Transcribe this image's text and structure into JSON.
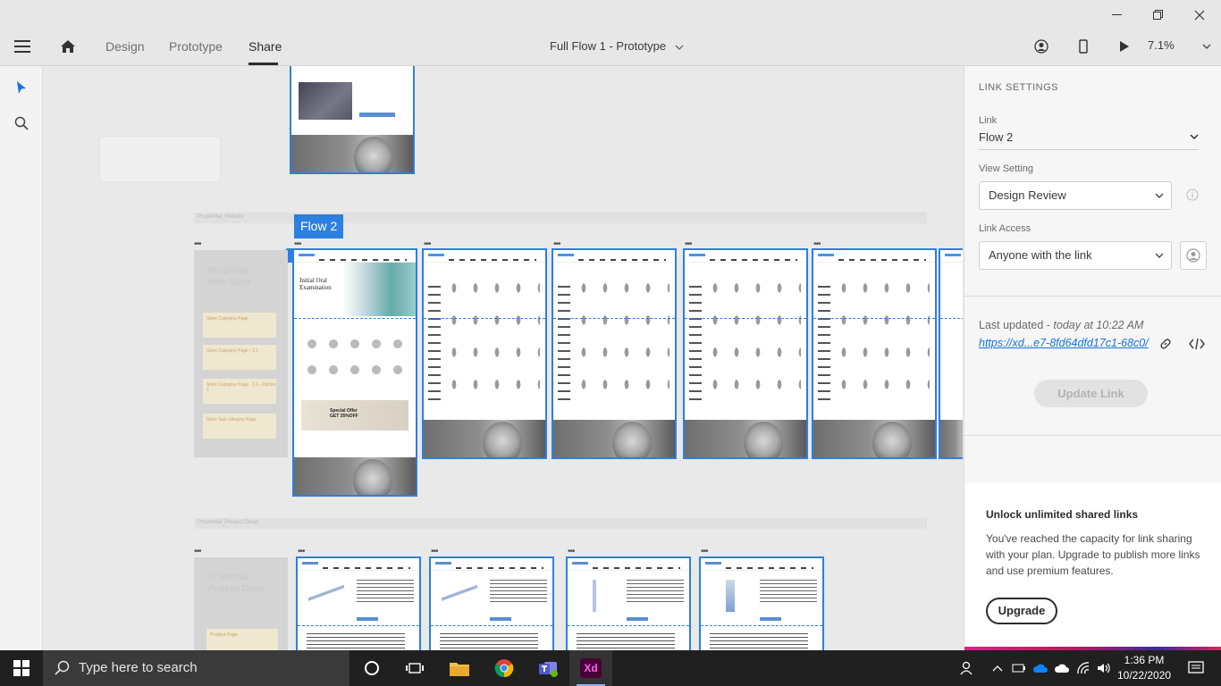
{
  "toolbar": {
    "tabs": [
      {
        "label": "Design"
      },
      {
        "label": "Prototype"
      },
      {
        "label": "Share"
      }
    ],
    "doc_title": "Full Flow 1 - Prototype",
    "zoom": "7.1%"
  },
  "canvas": {
    "flow_label": "Flow 2",
    "section_labels": [
      "Prudential_Website",
      "Prudential_Product Detail"
    ],
    "notes_1": {
      "title_line1": "Prudential",
      "title_line2": "Web Store",
      "stickies": [
        "Store Category Page",
        "Store Category Page - 1.1",
        "Store Category Page - 1.1 - Option 1",
        "Store Sub category Page"
      ]
    },
    "notes_2": {
      "title_line1": "Prudential",
      "title_line2": "Product Detail",
      "stickies": [
        "Product Page"
      ]
    },
    "hero_text": "Initial Oral Examination",
    "promo_text": "Special Offer GET 35%OFF"
  },
  "panel": {
    "heading": "LINK SETTINGS",
    "link_label": "Link",
    "link_value": "Flow 2",
    "view_label": "View Setting",
    "view_value": "Design Review",
    "access_label": "Link Access",
    "access_value": "Anyone with the link",
    "last_updated_prefix": "Last updated - ",
    "last_updated_time": "today at 10:22 AM",
    "url": "https://xd...e7-8fd64dfd17c1-68c0/",
    "update_button": "Update Link",
    "upsell_title": "Unlock unlimited shared links",
    "upsell_body": "You've reached the capacity for link sharing with your plan. Upgrade to publish more links and use premium features.",
    "upgrade_button": "Upgrade"
  },
  "taskbar": {
    "search_placeholder": "Type here to search",
    "time": "1:36 PM",
    "date": "10/22/2020"
  },
  "colors": {
    "accent": "#2d7fe0",
    "taskbar": "#202020",
    "xd": "#470137"
  }
}
